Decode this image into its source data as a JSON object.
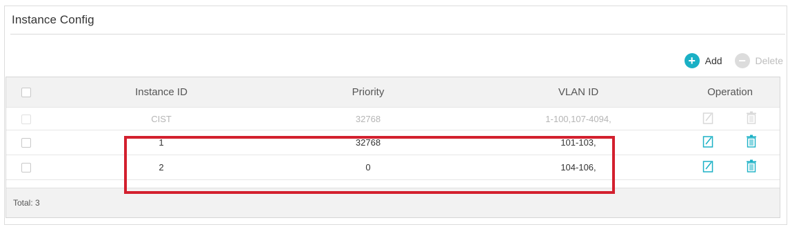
{
  "panel": {
    "title": "Instance Config"
  },
  "toolbar": {
    "add_label": "Add",
    "delete_label": "Delete"
  },
  "table": {
    "headers": [
      "Instance ID",
      "Priority",
      "VLAN ID",
      "Operation"
    ],
    "rows": [
      {
        "instance": "CIST",
        "priority": "32768",
        "vlan": "1-100,107-4094,",
        "state": "disabled"
      },
      {
        "instance": "1",
        "priority": "32768",
        "vlan": "101-103,",
        "state": "enabled"
      },
      {
        "instance": "2",
        "priority": "0",
        "vlan": "104-106,",
        "state": "enabled"
      }
    ],
    "footer": "Total: 3"
  },
  "colors": {
    "accent": "#1ab0c5",
    "highlight": "#d3202e",
    "header_bg": "#f2f2f2"
  },
  "icons": {
    "add": "plus-circle-icon",
    "delete": "minus-circle-icon",
    "edit": "edit-icon",
    "trash": "trash-icon"
  }
}
